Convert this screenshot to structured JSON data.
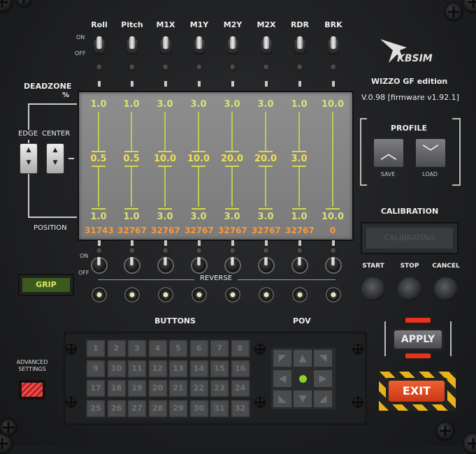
{
  "axes": [
    {
      "label": "Roll",
      "top": "1.0",
      "mid": "0.5",
      "bot": "1.0",
      "position": "31743"
    },
    {
      "label": "Pitch",
      "top": "1.0",
      "mid": "0.5",
      "bot": "1.0",
      "position": "32767"
    },
    {
      "label": "M1X",
      "top": "3.0",
      "mid": "10.0",
      "bot": "3.0",
      "position": "32767"
    },
    {
      "label": "M1Y",
      "top": "3.0",
      "mid": "10.0",
      "bot": "3.0",
      "position": "32767"
    },
    {
      "label": "M2Y",
      "top": "3.0",
      "mid": "20.0",
      "bot": "3.0",
      "position": "32767"
    },
    {
      "label": "M2X",
      "top": "3.0",
      "mid": "20.0",
      "bot": "3.0",
      "position": "32767"
    },
    {
      "label": "RDR",
      "top": "1.0",
      "mid": "3.0",
      "bot": "1.0",
      "position": "32767"
    },
    {
      "label": "BRK",
      "top": "10.0",
      "mid": "",
      "bot": "10.0",
      "position": "0"
    }
  ],
  "labels": {
    "on": "ON",
    "off": "OFF",
    "deadzone": "DEADZONE",
    "percent": "%",
    "edge": "EDGE",
    "center": "CENTER",
    "position": "POSITION",
    "reverse": "REVERSE",
    "grip": "GRIP",
    "buttons": "BUTTONS",
    "pov": "POV",
    "advanced": "ADVANCED SETTINGS",
    "profile": "PROFILE",
    "save": "SAVE",
    "load": "LOAD",
    "calibration": "CALIBRATION",
    "calibrating": "CALIBRATING",
    "start": "START",
    "stop": "STOP",
    "cancel": "CANCEL",
    "apply": "APPLY",
    "exit": "EXIT"
  },
  "brand": {
    "logo": "KBSIM",
    "edition": "WIZZO GF edition",
    "version": "V.0.98 [firmware v1.92.1]"
  },
  "buttons": [
    "1",
    "2",
    "3",
    "4",
    "5",
    "6",
    "7",
    "8",
    "9",
    "10",
    "11",
    "12",
    "13",
    "14",
    "15",
    "16",
    "17",
    "18",
    "19",
    "20",
    "21",
    "22",
    "23",
    "24",
    "25",
    "26",
    "27",
    "28",
    "29",
    "30",
    "31",
    "32"
  ],
  "colors": {
    "screen_value": "#d7e27a",
    "position_value": "#ff9933",
    "exit_red": "#e04020",
    "apply_red": "#e8321c"
  }
}
